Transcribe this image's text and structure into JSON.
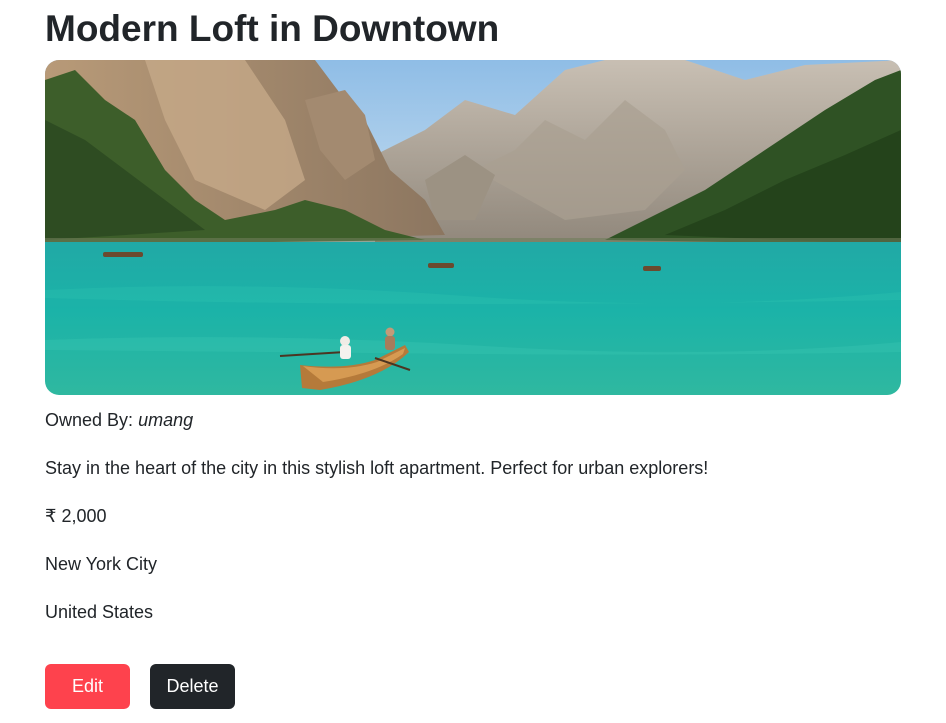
{
  "listing": {
    "title": "Modern Loft in Downtown",
    "image_description": "mountain lake with rowboats",
    "owner_label": "Owned By:",
    "owner_name": "umang",
    "description": "Stay in the heart of the city in this stylish loft apartment. Perfect for urban explorers!",
    "price": "₹ 2,000",
    "location": "New York City",
    "country": "United States"
  },
  "actions": {
    "edit_label": "Edit",
    "delete_label": "Delete"
  },
  "colors": {
    "edit_button": "#fe424d",
    "delete_button": "#212529",
    "text": "#212529"
  }
}
